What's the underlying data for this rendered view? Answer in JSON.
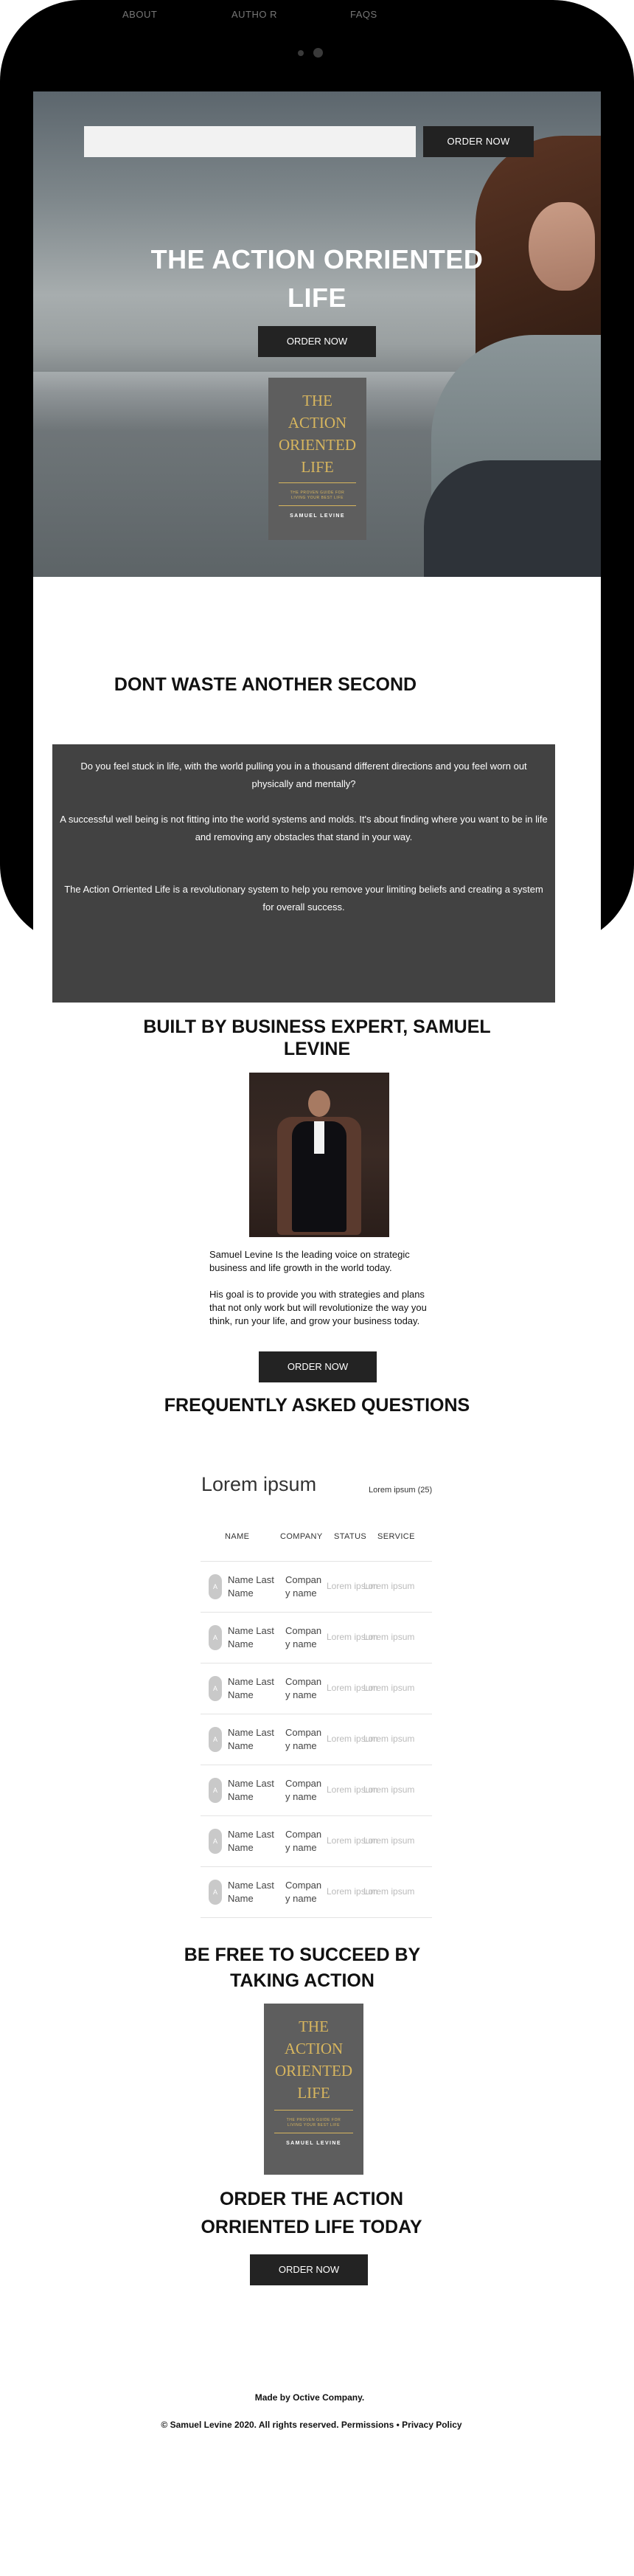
{
  "nav": {
    "about": "ABOUT",
    "author": "AUTHO R",
    "faqs": "FAQS",
    "order": "ORDER NOW"
  },
  "hero": {
    "title_line1": "THE ACTION ORRIENTED",
    "title_line2": "LIFE",
    "order_button": "ORDER NOW"
  },
  "book": {
    "title_l1": "THE",
    "title_l2": "ACTION",
    "title_l3": "ORIENTED",
    "title_l4": "LIFE",
    "subtitle_l1": "THE PROVEN GUIDE FOR",
    "subtitle_l2": "LIVING YOUR BEST LIFE",
    "author": "SAMUEL LEVINE"
  },
  "waste": {
    "heading": "DONT  WASTE ANOTHER SECOND",
    "p1": "Do you feel stuck in life, with the world pulling you in a thousand different directions and you feel worn out physically and mentally?",
    "p2": "A successful well being is not fitting into the world systems and molds. It's about finding where you want to be in life and removing any obstacles that stand in  your way.",
    "p3": "The  Action Orriented Life is a revolutionary system to help you remove your limiting beliefs and creating a system for overall success."
  },
  "author": {
    "heading_l1": "BUILT BY BUSINESS EXPERT, SAMUEL",
    "heading_l2": "LEVINE",
    "bio1": "Samuel Levine Is the leading voice on strategic business and life growth in the world today.",
    "bio2": "His goal is to provide you with strategies and plans that not only work but will revolutionize the way you think, run your life, and grow your business today.",
    "order_button": "ORDER NOW"
  },
  "faq": {
    "heading": "FREQUENTLY ASKED QUESTIONS",
    "table_title": "Lorem ipsum",
    "count": "Lorem ipsum (25)",
    "headers": {
      "name": "NAME",
      "company": "COMPANY",
      "status": "STATUS",
      "service": "SERVICE"
    },
    "rows": [
      {
        "avatar": "A",
        "name": "Name Last Name",
        "company": "Compan y name",
        "status": "Lorem ipsum",
        "service": "Lorem ipsum"
      },
      {
        "avatar": "A",
        "name": "Name Last Name",
        "company": "Compan y name",
        "status": "Lorem ipsum",
        "service": "Lorem ipsum"
      },
      {
        "avatar": "A",
        "name": "Name Last Name",
        "company": "Compan y name",
        "status": "Lorem ipsum",
        "service": "Lorem ipsum"
      },
      {
        "avatar": "A",
        "name": "Name Last Name",
        "company": "Compan y name",
        "status": "Lorem ipsum",
        "service": "Lorem ipsum"
      },
      {
        "avatar": "A",
        "name": "Name Last Name",
        "company": "Compan y name",
        "status": "Lorem ipsum",
        "service": "Lorem ipsum"
      },
      {
        "avatar": "A",
        "name": "Name Last Name",
        "company": "Compan y name",
        "status": "Lorem ipsum",
        "service": "Lorem ipsum"
      },
      {
        "avatar": "A",
        "name": "Name Last Name",
        "company": "Compan y name",
        "status": "Lorem ipsum",
        "service": "Lorem ipsum"
      }
    ]
  },
  "cta": {
    "free_l1": "BE FREE TO SUCCEED BY",
    "free_l2": "TAKING ACTION",
    "order_l1": "ORDER THE ACTION",
    "order_l2": "ORRIENTED LIFE TODAY",
    "order_button": "ORDER NOW"
  },
  "footer": {
    "made_by": "Made by Octive Company.",
    "copyright": "© Samuel Levine 2020. All rights reserved. Permissions • Privacy Policy"
  },
  "colors": {
    "dark_button": "#232323",
    "book_cover": "#5e5e5e",
    "book_gold": "#d8b65e",
    "text_panel": "#424242"
  }
}
